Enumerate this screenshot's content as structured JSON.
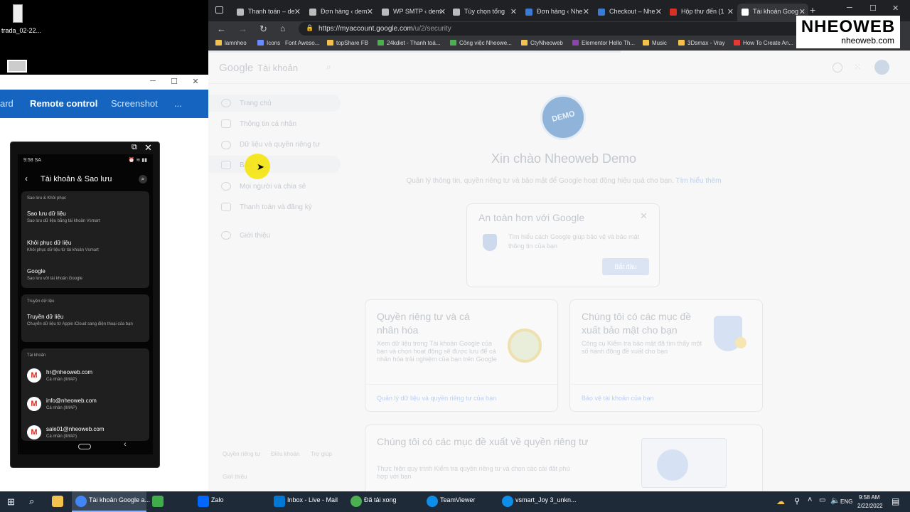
{
  "desktop": {
    "icon_label": "trada_02-22..."
  },
  "remote_window": {
    "tabs": [
      "ard",
      "Remote control",
      "Screenshot",
      "..."
    ]
  },
  "phone": {
    "status_time": "9:58 SA",
    "screen_title": "Tài khoản & Sao lưu",
    "section1": "Sao lưu & Khôi phục",
    "item1_title": "Sao lưu dữ liệu",
    "item1_sub": "Sao lưu dữ liệu bằng tài khoản Vsmart",
    "item2_title": "Khôi phục dữ liệu",
    "item2_sub": "Khôi phục dữ liệu từ tài khoản Vsmart",
    "item3_title": "Google",
    "item3_sub": "Sao lưu với tài khoản Google",
    "section2": "Truyền dữ liệu",
    "item4_title": "Truyền dữ liệu",
    "item4_sub": "Chuyển dữ liệu từ Apple iCloud sang điện thoại của bạn",
    "section3": "Tài khoản",
    "accounts": [
      {
        "email": "hr@nheoweb.com",
        "type": "Cá nhân (IMAP)"
      },
      {
        "email": "info@nheoweb.com",
        "type": "Cá nhân (IMAP)"
      },
      {
        "email": "sale01@nheoweb.com",
        "type": "Cá nhân (IMAP)"
      }
    ]
  },
  "browser": {
    "tabs": [
      "Thanh toán – de",
      "Đơn hàng ‹ dem",
      "WP SMTP ‹ dem",
      "Tùy chọn tổng",
      "Đơn hàng ‹ Nhe",
      "Checkout – Nhe",
      "Hộp thư đến (1",
      "Tài khoản Goog"
    ],
    "url_host": "https://myaccount.google.com",
    "url_path": "/u/2/security",
    "bookmarks": [
      "lamnheo",
      "Icons",
      "Font Aweso...",
      "topShare FB",
      "24kdiet - Thanh toá...",
      "Công việc Nheowe...",
      "CtyNheoweb",
      "Elementor Hello Th...",
      "Music",
      "3Dsmax - Vray",
      "How To Create An..."
    ],
    "logo_text": "NHEOWEB",
    "logo_sub": "nheoweb.com"
  },
  "google_page": {
    "brand": "Google",
    "brand_sub": "Tài khoản",
    "nav": [
      "Trang chủ",
      "Thông tin cá nhân",
      "Dữ liệu và quyền riêng tư",
      "Bảo",
      "Mọi người và chia sẻ",
      "Thanh toán và đăng ký",
      "Giới thiệu"
    ],
    "avatar_text": "DEMO",
    "greeting": "Xin chào Nheoweb Demo",
    "subtitle": "Quản lý thông tin, quyền riêng tư và bảo mật để Google hoạt động hiệu quả cho bạn.",
    "learn_more": "Tìm hiểu thêm",
    "safer_title": "An toàn hơn với Google",
    "safer_body": "Tìm hiểu cách Google giúp bảo vệ và bảo mật thông tin của bạn",
    "safer_button": "Bắt đầu",
    "card1_title": "Quyền riêng tư và cá nhân hóa",
    "card1_body": "Xem dữ liệu trong Tài khoản Google của bạn và chọn hoạt động sẽ được lưu để cá nhân hóa trải nghiệm của bạn trên Google",
    "card1_link": "Quản lý dữ liệu và quyền riêng tư của bạn",
    "card2_title": "Chúng tôi có các mục đề xuất bảo mật cho bạn",
    "card2_body": "Công cụ Kiểm tra bảo mật đã tìm thấy một số hành động đề xuất cho bạn",
    "card2_link": "Bảo vệ tài khoản của bạn",
    "card3_title": "Chúng tôi có các mục đề xuất về quyền riêng tư",
    "card3_body": "Thực hiện quy trình Kiểm tra quyền riêng tư và chọn các cài đặt phù hợp với bạn",
    "footer": [
      "Quyền riêng tư",
      "Điều khoản",
      "Trợ giúp",
      "Giới thiệu"
    ]
  },
  "taskbar": {
    "apps": [
      "Tài khoản Google a...",
      "Zalo",
      "Inbox - Live - Mail",
      "Đã tải xong",
      "TeamViewer",
      "vsmart_Joy 3_unkn..."
    ],
    "lang": "ENG",
    "time": "9:58 AM",
    "date": "2/22/2022"
  },
  "colors": {
    "rc_blue": "#1565c0",
    "cursor_highlight": "#f5e400"
  }
}
